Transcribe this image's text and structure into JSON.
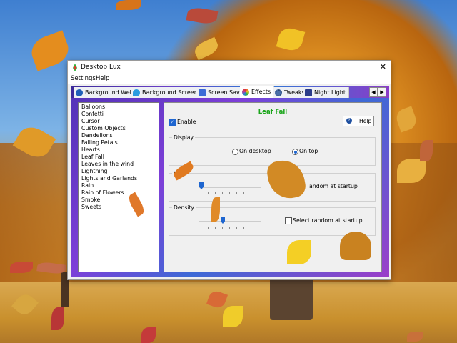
{
  "window": {
    "title": "Desktop Lux",
    "close_glyph": "✕"
  },
  "menu": [
    "Settings",
    "Help"
  ],
  "tabs": [
    {
      "label": "Background Web",
      "icon": "globe-icon",
      "color": "#1e5fb8"
    },
    {
      "label": "Background Screen Saver",
      "icon": "drop-icon",
      "color": "#2a9be0"
    },
    {
      "label": "Screen Saver",
      "icon": "monitor-icon",
      "color": "#3b6bd6"
    },
    {
      "label": "Effects",
      "icon": "effects-icon",
      "color": "#c83c8c",
      "active": true
    },
    {
      "label": "Tweaks",
      "icon": "gear-icon",
      "color": "#4a6fa8"
    },
    {
      "label": "Night Light",
      "icon": "moon-icon",
      "color": "#2b3c8a"
    }
  ],
  "tab_scroll": {
    "left": "◀",
    "right": "▶"
  },
  "effects_list": [
    "Balloons",
    "Confetti",
    "Cursor",
    "Custom Objects",
    "Dandelions",
    "Falling Petals",
    "Hearts",
    "Leaf Fall",
    "Leaves in the wind",
    "Lightning",
    "Lights and Garlands",
    "Rain",
    "Rain of Flowers",
    "Smoke",
    "Sweets"
  ],
  "panel": {
    "title": "Leaf Fall",
    "enable_label": "Enable",
    "enable_checked": true,
    "help_label": "Help",
    "display": {
      "title": "Display",
      "on_desktop": "On desktop",
      "on_top": "On top",
      "selected": "On top"
    },
    "wind": {
      "title": "Wi",
      "random_label": "andom at startup",
      "level": 0.05
    },
    "density": {
      "title": "Density",
      "random_label": "Select random at startup",
      "level": 0.35
    }
  },
  "colors": {
    "accent": "#1e66d0",
    "title_green": "#1aa51a"
  }
}
